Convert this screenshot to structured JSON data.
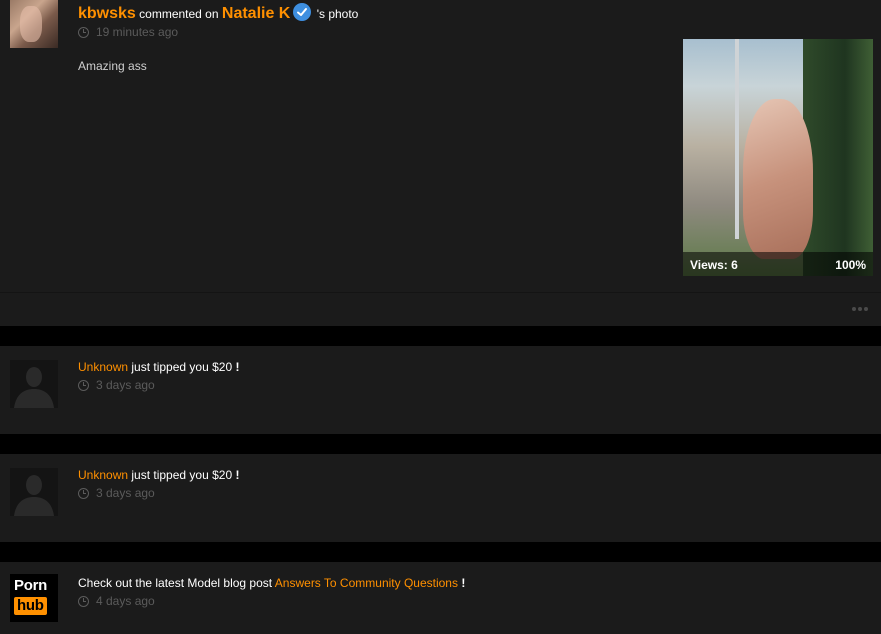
{
  "notifications": [
    {
      "user": "kbwsks",
      "action": "commented on",
      "target": "Natalie K",
      "suffix": "'s photo",
      "time": "19 minutes ago",
      "comment": "Amazing ass",
      "thumbnail": {
        "views_label": "Views: 6",
        "rating": "100%"
      }
    },
    {
      "user": "Unknown",
      "action": "just tipped you $20",
      "exclaim": "!",
      "time": "3 days ago"
    },
    {
      "user": "Unknown",
      "action": "just tipped you $20",
      "exclaim": "!",
      "time": "3 days ago"
    },
    {
      "prefix": "Check out the latest Model blog post",
      "link": "Answers To Community Questions",
      "exclaim": "!",
      "time": "4 days ago",
      "logo": {
        "line1": "Porn",
        "line2": "hub"
      }
    }
  ],
  "icons": {
    "verified": "verified-check-icon",
    "clock": "clock-icon",
    "more": "more-options-icon"
  },
  "colors": {
    "accent": "#ff9000",
    "verified": "#3e8fe0",
    "card_bg": "#1b1b1b",
    "page_bg": "#000000"
  }
}
